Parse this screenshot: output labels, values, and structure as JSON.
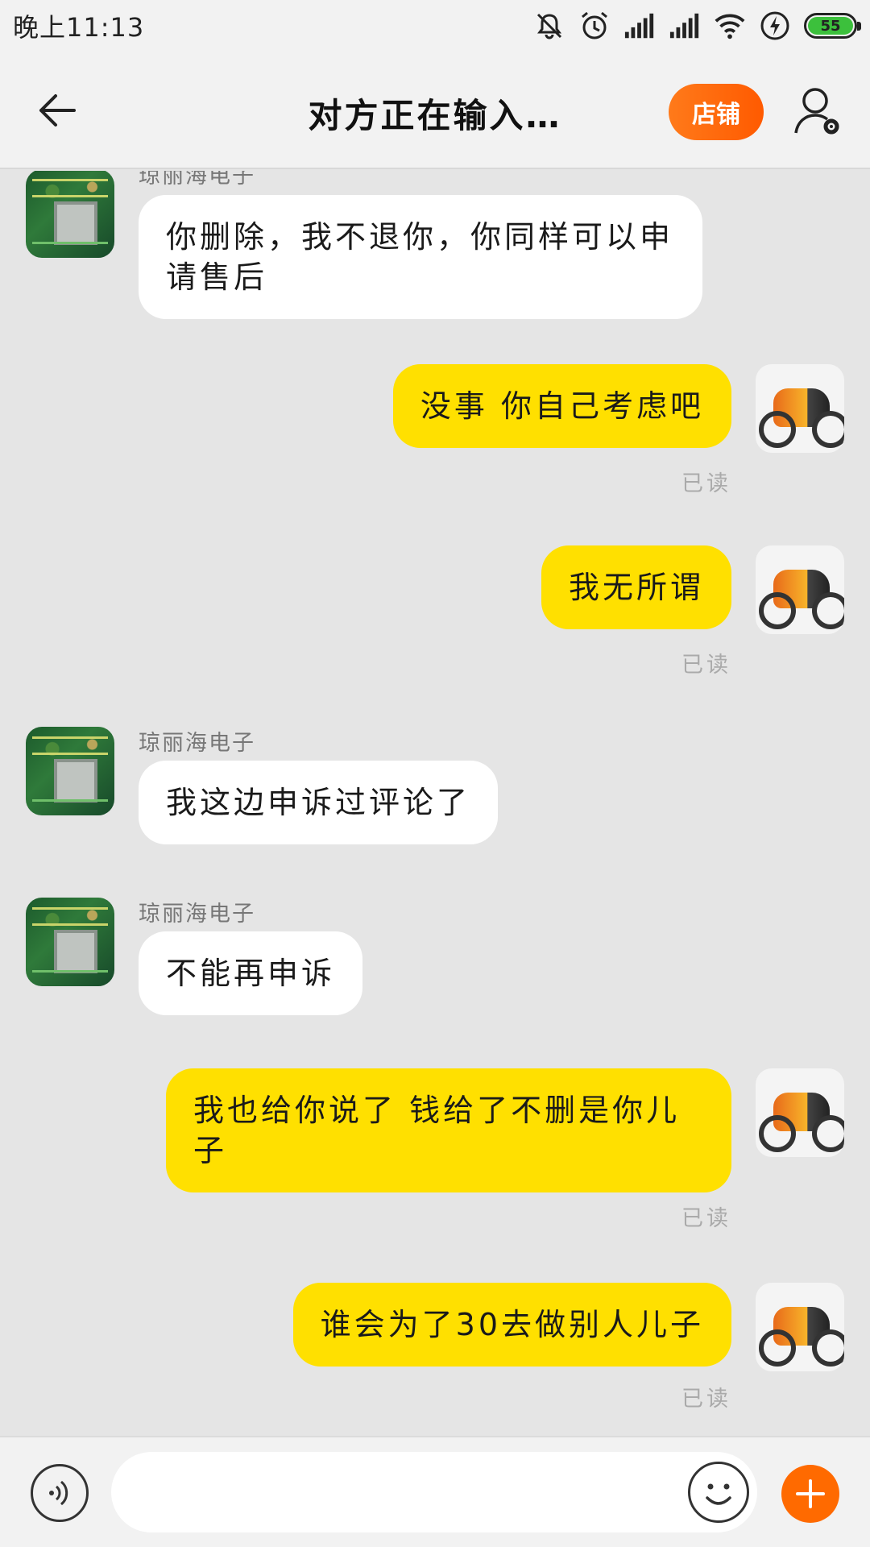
{
  "status_bar": {
    "time": "晚上11:13",
    "battery_level": "55",
    "icons": [
      "mute-icon",
      "alarm-icon",
      "signal-icon",
      "signal-icon",
      "wifi-icon",
      "charging-icon",
      "battery-icon"
    ]
  },
  "nav": {
    "title": "对方正在输入…",
    "shop_label": "店铺",
    "back_icon": "arrow-left-icon",
    "user_icon": "user-settings-icon"
  },
  "messages": [
    {
      "side": "in",
      "sender": "琼丽海电子",
      "text": "你删除，我不退你，你同样可以申请售后"
    },
    {
      "side": "out",
      "text": "没事 你自己考虑吧",
      "status": "已读"
    },
    {
      "side": "out",
      "text": "我无所谓",
      "status": "已读"
    },
    {
      "side": "in",
      "sender": "琼丽海电子",
      "text": "我这边申诉过评论了"
    },
    {
      "side": "in",
      "sender": "琼丽海电子",
      "text": "不能再申诉"
    },
    {
      "side": "out",
      "text": "我也给你说了 钱给了不删是你儿子",
      "status": "已读"
    },
    {
      "side": "out",
      "text": "谁会为了30去做别人儿子",
      "status": "已读"
    }
  ],
  "input_bar": {
    "placeholder": "",
    "voice_icon": "voice-icon",
    "emoji_icon": "emoji-icon",
    "plus_icon": "plus-icon"
  },
  "colors": {
    "outgoing_bubble": "#ffe000",
    "incoming_bubble": "#ffffff",
    "accent": "#ff6a00",
    "background": "#e5e5e5"
  }
}
